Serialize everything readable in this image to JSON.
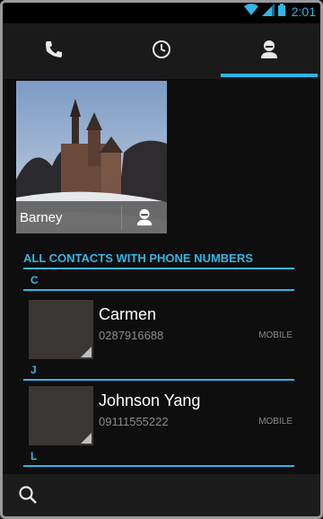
{
  "status_bar": {
    "time": "2:01",
    "accent": "#33b5e5"
  },
  "tabs": [
    {
      "icon": "phone-icon",
      "active": false
    },
    {
      "icon": "clock-icon",
      "active": false
    },
    {
      "icon": "contact-icon",
      "active": true
    }
  ],
  "favorite": {
    "name": "Barney"
  },
  "list": {
    "header": "ALL CONTACTS WITH PHONE NUMBERS",
    "sections": [
      {
        "letter": "C"
      },
      {
        "letter": "J"
      },
      {
        "letter": "L"
      }
    ],
    "contacts": [
      {
        "name": "Carmen",
        "number": "0287916688",
        "type": "MOBILE"
      },
      {
        "name": "Johnson Yang",
        "number": "09111555222",
        "type": "MOBILE"
      }
    ]
  },
  "bottom": {
    "icon": "search-icon"
  }
}
